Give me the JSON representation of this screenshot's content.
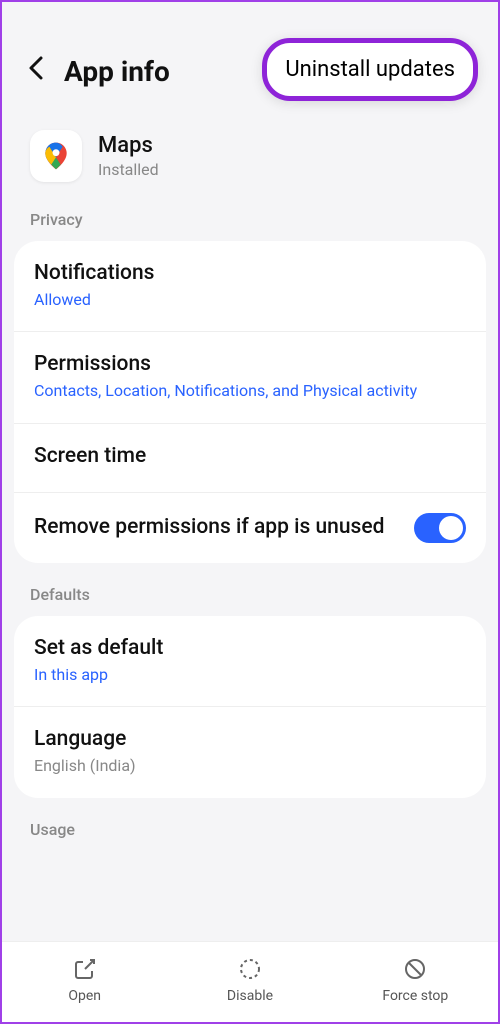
{
  "header": {
    "title": "App info",
    "menu_item": "Uninstall updates"
  },
  "app": {
    "name": "Maps",
    "status": "Installed"
  },
  "sections": {
    "privacy_label": "Privacy",
    "defaults_label": "Defaults",
    "usage_label": "Usage"
  },
  "privacy": {
    "notifications": {
      "title": "Notifications",
      "sub": "Allowed"
    },
    "permissions": {
      "title": "Permissions",
      "sub": "Contacts, Location, Notifications, and Physical activity"
    },
    "screen_time": {
      "title": "Screen time"
    },
    "remove_perms": {
      "title": "Remove permissions if app is unused"
    }
  },
  "defaults": {
    "set_default": {
      "title": "Set as default",
      "sub": "In this app"
    },
    "language": {
      "title": "Language",
      "sub": "English (India)"
    }
  },
  "bottom": {
    "open": "Open",
    "disable": "Disable",
    "force_stop": "Force stop"
  }
}
